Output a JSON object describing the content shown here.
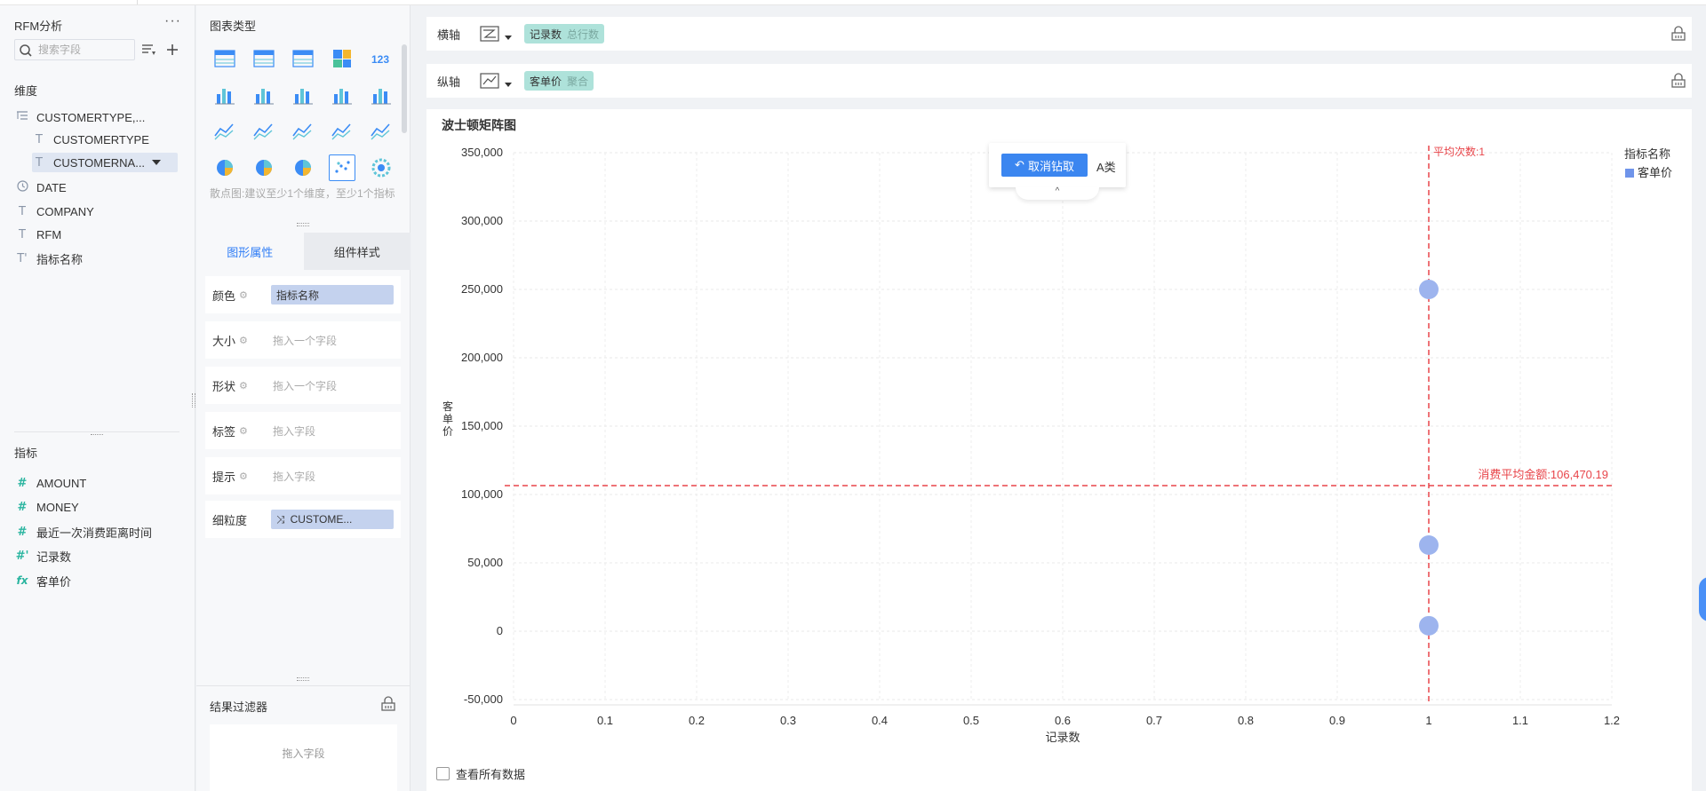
{
  "left_panel": {
    "title": "RFM分析",
    "more": "···",
    "search_placeholder": "搜索字段",
    "dimension_label": "维度",
    "dimensions": [
      {
        "icon": "hierarchy-icon",
        "label": "CUSTOMERTYPE,..."
      },
      {
        "icon": "text-type-icon",
        "label": "CUSTOMERTYPE"
      },
      {
        "icon": "text-type-icon",
        "label": "CUSTOMERNA..."
      },
      {
        "icon": "date-type-icon",
        "label": "DATE"
      },
      {
        "icon": "text-type-icon",
        "label": "COMPANY"
      },
      {
        "icon": "text-type-icon",
        "label": "RFM"
      },
      {
        "icon": "text-type-icon",
        "label": "指标名称"
      }
    ],
    "measure_label": "指标",
    "measures": [
      {
        "icon": "number-type-icon",
        "label": "AMOUNT"
      },
      {
        "icon": "number-type-icon",
        "label": "MONEY"
      },
      {
        "icon": "number-type-icon",
        "label": "最近一次消费距离时间"
      },
      {
        "icon": "number-type-icon",
        "label": "记录数"
      },
      {
        "icon": "formula-icon",
        "label": "客单价"
      }
    ]
  },
  "chart_type_panel": {
    "title": "图表类型",
    "hint": "散点图:建议至少1个维度，至少1个指标",
    "tabs": {
      "shape_properties": "图形属性",
      "component_style": "组件样式"
    },
    "properties": [
      {
        "label": "颜色",
        "value": "指标名称",
        "filled": true
      },
      {
        "label": "大小",
        "value": "拖入一个字段",
        "filled": false
      },
      {
        "label": "形状",
        "value": "拖入一个字段",
        "filled": false
      },
      {
        "label": "标签",
        "value": "拖入字段",
        "filled": false
      },
      {
        "label": "提示",
        "value": "拖入字段",
        "filled": false
      },
      {
        "label": "细粒度",
        "value": "CUSTOME...",
        "filled": true
      }
    ],
    "filter_title": "结果过滤器",
    "filter_placeholder": "拖入字段"
  },
  "axes": {
    "x_label": "横轴",
    "x_field": "记录数",
    "x_field_sub": "总行数",
    "y_label": "纵轴",
    "y_field": "客单价",
    "y_field_sub": "聚合"
  },
  "drill": {
    "cancel_label": "取消钻取",
    "crumb": "A类",
    "collapse": "^"
  },
  "view_all_label": "查看所有数据",
  "colors": {
    "accent": "#2f7df6",
    "point": "#9db4ee",
    "ref_line": "#e8454a",
    "pill": "#aee2da",
    "chip": "#c4d2ee"
  },
  "chart_data": {
    "type": "scatter",
    "title": "波士顿矩阵图",
    "xlabel": "记录数",
    "ylabel": "客单价",
    "xlim": [
      0,
      1.2
    ],
    "ylim": [
      -50000,
      350000
    ],
    "x_ticks": [
      "0",
      "0.1",
      "0.2",
      "0.3",
      "0.4",
      "0.5",
      "0.6",
      "0.7",
      "0.8",
      "0.9",
      "1",
      "1.1",
      "1.2"
    ],
    "y_ticks": [
      "350,000",
      "300,000",
      "250,000",
      "200,000",
      "150,000",
      "100,000",
      "50,000",
      "0",
      "-50,000"
    ],
    "legend_title": "指标名称",
    "legend_position": "top-right",
    "series": [
      {
        "name": "客单价",
        "points": [
          [
            1,
            250000
          ],
          [
            1,
            63000
          ],
          [
            1,
            4000
          ]
        ]
      }
    ],
    "reference_lines": [
      {
        "axis": "x",
        "value": 1,
        "label": "平均次数:1"
      },
      {
        "axis": "y",
        "value": 106470.19,
        "label": "消费平均金额:106,470.19"
      }
    ],
    "grid": true
  }
}
